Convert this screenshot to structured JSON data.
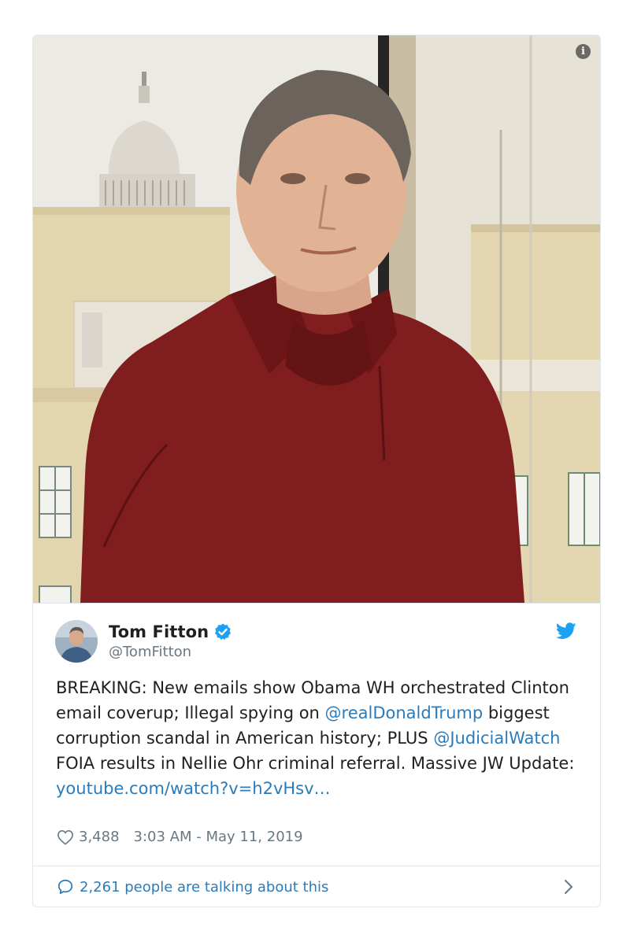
{
  "media": {
    "info_glyph": "i"
  },
  "author": {
    "name": "Tom Fitton",
    "handle": "@TomFitton",
    "verified": true
  },
  "tweet": {
    "text_parts": [
      "BREAKING: New emails show Obama WH orchestrated Clinton email coverup; Illegal spying on ",
      "@realDonaldTrump",
      " biggest corruption scandal in American history; PLUS ",
      "@JudicialWatch",
      " FOIA results in Nellie Ohr criminal referral. Massive JW Update: ",
      "youtube.com/watch?v=h2vHsv…"
    ],
    "likes": "3,488",
    "timestamp": "3:03 AM - May 11, 2019"
  },
  "footer": {
    "talking": "2,261 people are talking about this"
  },
  "icons": {
    "info": "info-icon",
    "verified": "verified-badge-icon",
    "platform": "twitter-bird-icon",
    "like": "heart-icon",
    "talk": "speech-bubble-icon",
    "more": "chevron-right-icon"
  },
  "colors": {
    "link": "#2b7bb9",
    "muted": "#697882",
    "verified": "#1da1f2",
    "bird": "#1da1f2"
  }
}
